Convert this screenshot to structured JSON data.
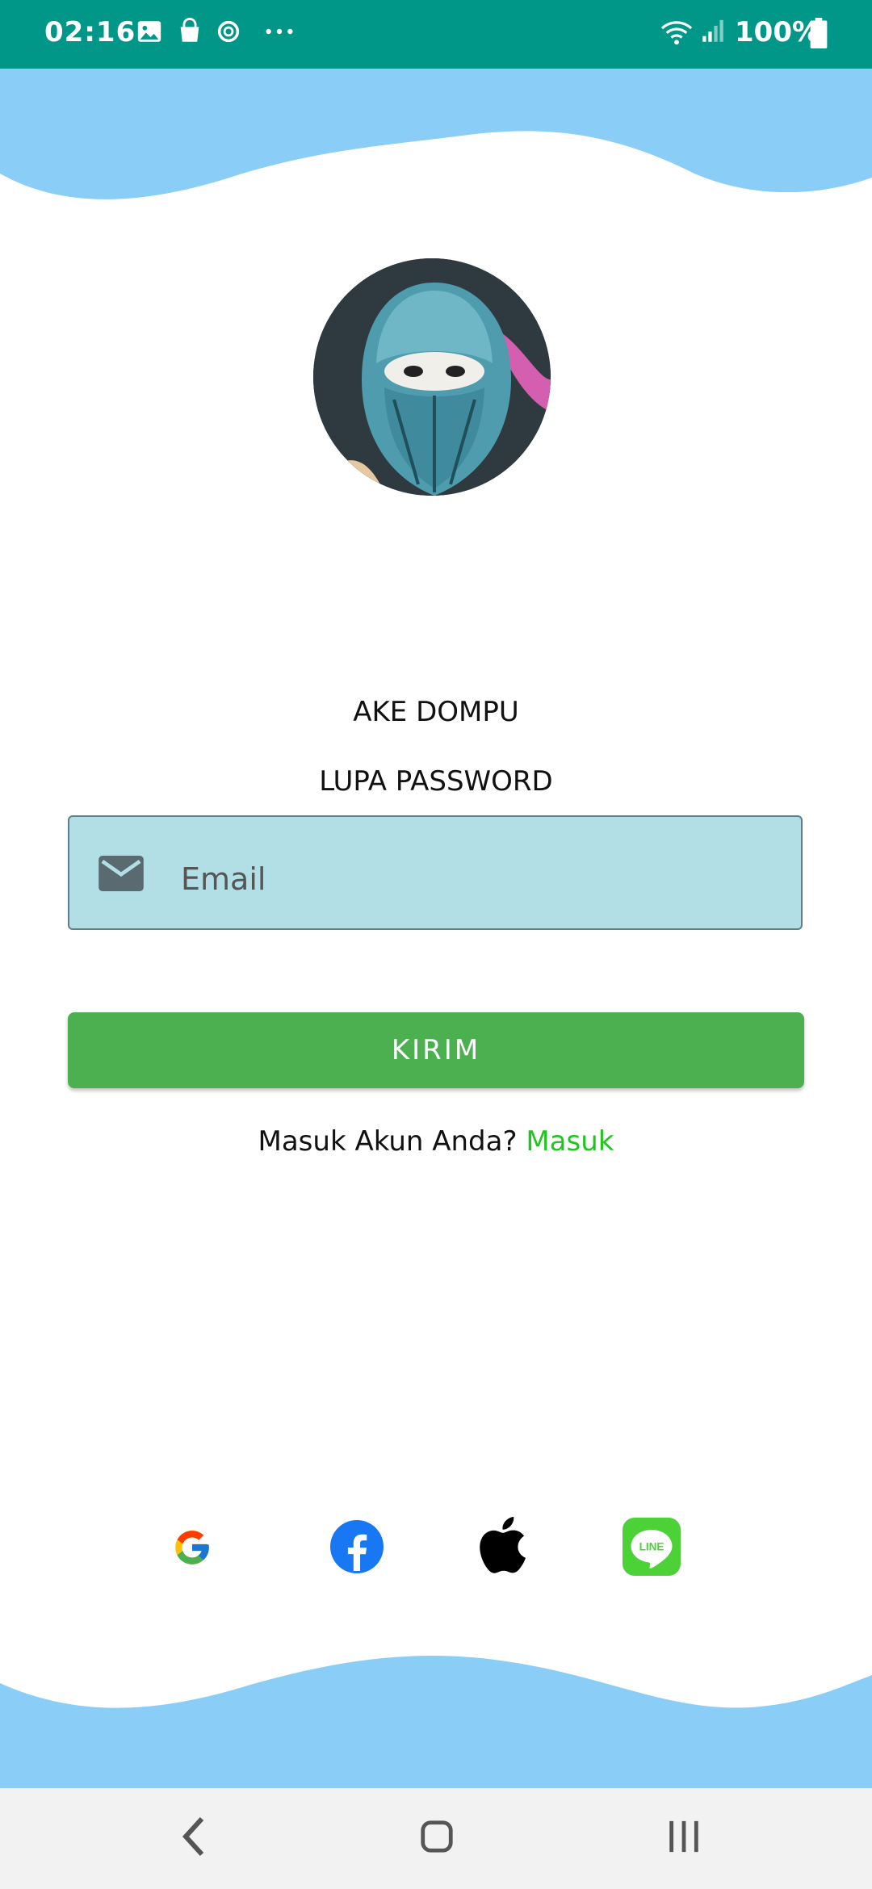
{
  "status_bar": {
    "time": "02:16",
    "battery": "100%",
    "icons": [
      "gallery-icon",
      "shopping-bag-icon",
      "sync-icon",
      "more-dots-icon",
      "wifi-icon",
      "signal-icon",
      "battery-icon"
    ]
  },
  "app": {
    "name": "AKE DOMPU",
    "page_title": "LUPA PASSWORD"
  },
  "form": {
    "email_placeholder": "Email",
    "email_value": "",
    "submit_label": "KIRIM"
  },
  "login_prompt": {
    "text": "Masuk Akun Anda?",
    "link": "Masuk"
  },
  "social": [
    "google-icon",
    "facebook-icon",
    "apple-icon",
    "line-icon"
  ],
  "colors": {
    "status_bar": "#009688",
    "wave": "#8ACEF7",
    "input_bg": "#B2DFE6",
    "button": "#4CAF50",
    "link": "#1EC61E"
  },
  "navigation": [
    "back-icon",
    "home-icon",
    "recents-icon"
  ]
}
